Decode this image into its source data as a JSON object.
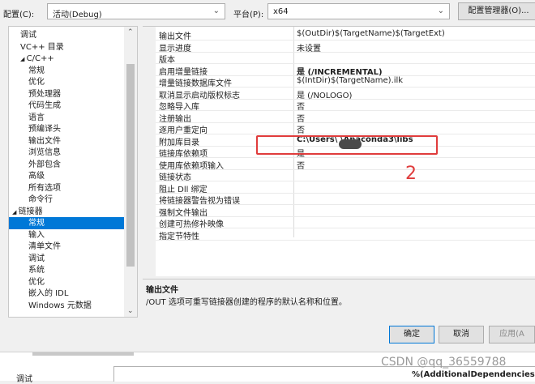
{
  "config": {
    "config_label": "配置(C):",
    "config_value": "活动(Debug)",
    "platform_label": "平台(P):",
    "platform_value": "x64",
    "manager_button": "配置管理器(O)..."
  },
  "tree": {
    "items": [
      {
        "label": "调试",
        "indent": 1,
        "arrow": ""
      },
      {
        "label": "VC++ 目录",
        "indent": 1,
        "arrow": ""
      },
      {
        "label": "C/C++",
        "indent": 1,
        "arrow": "◢"
      },
      {
        "label": "常规",
        "indent": 2,
        "arrow": ""
      },
      {
        "label": "优化",
        "indent": 2,
        "arrow": ""
      },
      {
        "label": "预处理器",
        "indent": 2,
        "arrow": ""
      },
      {
        "label": "代码生成",
        "indent": 2,
        "arrow": ""
      },
      {
        "label": "语言",
        "indent": 2,
        "arrow": ""
      },
      {
        "label": "预编译头",
        "indent": 2,
        "arrow": ""
      },
      {
        "label": "输出文件",
        "indent": 2,
        "arrow": ""
      },
      {
        "label": "浏览信息",
        "indent": 2,
        "arrow": ""
      },
      {
        "label": "外部包含",
        "indent": 2,
        "arrow": ""
      },
      {
        "label": "高级",
        "indent": 2,
        "arrow": ""
      },
      {
        "label": "所有选项",
        "indent": 2,
        "arrow": ""
      },
      {
        "label": "命令行",
        "indent": 2,
        "arrow": ""
      },
      {
        "label": "链接器",
        "indent": 0,
        "arrow": "◢"
      },
      {
        "label": "常规",
        "indent": 2,
        "arrow": "",
        "selected": true
      },
      {
        "label": "输入",
        "indent": 2,
        "arrow": ""
      },
      {
        "label": "清单文件",
        "indent": 2,
        "arrow": ""
      },
      {
        "label": "调试",
        "indent": 2,
        "arrow": ""
      },
      {
        "label": "系统",
        "indent": 2,
        "arrow": ""
      },
      {
        "label": "优化",
        "indent": 2,
        "arrow": ""
      },
      {
        "label": "嵌入的 IDL",
        "indent": 2,
        "arrow": ""
      },
      {
        "label": "Windows 元数据",
        "indent": 2,
        "arrow": ""
      }
    ],
    "scroll_up": "⌃",
    "scroll_down": "⌄"
  },
  "properties": [
    {
      "name": "输出文件",
      "value": "$(OutDir)$(TargetName)$(TargetExt)",
      "bold": false
    },
    {
      "name": "显示进度",
      "value": "未设置",
      "bold": false
    },
    {
      "name": "版本",
      "value": "",
      "bold": false
    },
    {
      "name": "启用增量链接",
      "value": "是 (/INCREMENTAL)",
      "bold": true
    },
    {
      "name": "增量链接数据库文件",
      "value": "$(IntDir)$(TargetName).ilk",
      "bold": false
    },
    {
      "name": "取消显示启动版权标志",
      "value": "是 (/NOLOGO)",
      "bold": false
    },
    {
      "name": "忽略导入库",
      "value": "否",
      "bold": false
    },
    {
      "name": "注册输出",
      "value": "否",
      "bold": false
    },
    {
      "name": "逐用户重定向",
      "value": "否",
      "bold": false
    },
    {
      "name": "附加库目录",
      "value": "C:\\Users\\        \\Anaconda3\\libs",
      "bold": true
    },
    {
      "name": "链接库依赖项",
      "value": "是",
      "bold": false
    },
    {
      "name": "使用库依赖项输入",
      "value": "否",
      "bold": false
    },
    {
      "name": "链接状态",
      "value": "",
      "bold": false
    },
    {
      "name": "阻止 Dll 绑定",
      "value": "",
      "bold": false
    },
    {
      "name": "将链接器警告视为错误",
      "value": "",
      "bold": false
    },
    {
      "name": "强制文件输出",
      "value": "",
      "bold": false
    },
    {
      "name": "创建可热修补映像",
      "value": "",
      "bold": false
    },
    {
      "name": "指定节特性",
      "value": "",
      "bold": false
    }
  ],
  "annotation": {
    "number": "2",
    "color": "#e03c3c"
  },
  "description": {
    "title": "输出文件",
    "text": "/OUT 选项可重写链接器创建的程序的默认名称和位置。"
  },
  "buttons": {
    "ok": "确定",
    "cancel": "取消",
    "apply": "应用(A"
  },
  "fragment": {
    "left_label": "调试",
    "value": "%(AdditionalDependencies",
    "watermark": "CSDN @qq_36559788"
  },
  "colors": {
    "selection": "#0078d7",
    "accent_border": "#0078d7"
  }
}
